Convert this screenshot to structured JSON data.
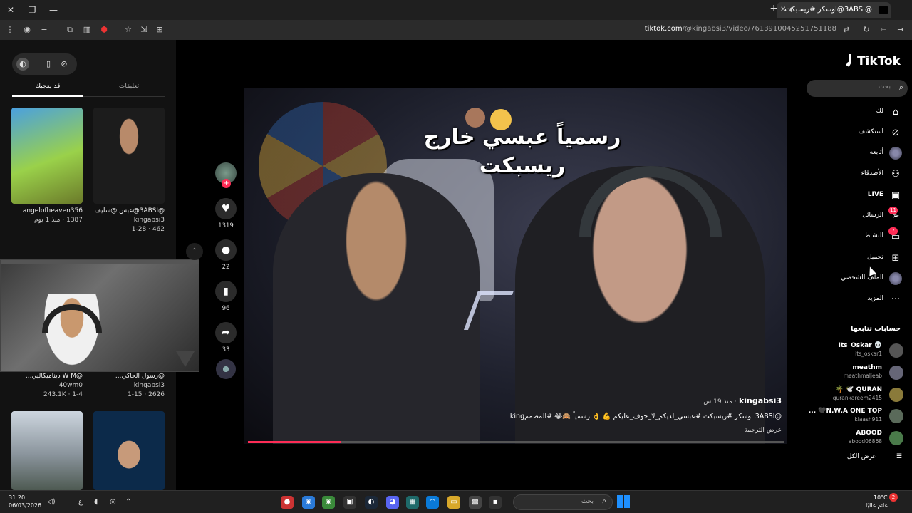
{
  "browser": {
    "tab_title": "@3ABSI@اوسكر #ريسبكت",
    "url_domain": "tiktok.com",
    "url_path": "/@kingabsi3/video/7613910045251751188"
  },
  "left_panel": {
    "tab_active": "قد يعجبك",
    "tab_other": "تعليقات",
    "cards": [
      {
        "title": "angelofheaven356",
        "meta": "1387 · منذ 1 يوم"
      },
      {
        "title": "@3ABSI@عبس @سليف 7madh@...",
        "sub": "kingabsi3",
        "meta": "462 · 1-28"
      },
      {
        "title": "@W M ديناميكاليي...",
        "sub": "40wm0",
        "meta": "243.1K · 1-4"
      },
      {
        "title": "@رسول الحاكي...",
        "sub": "kingabsi3",
        "meta": "2626 · 1-15"
      }
    ]
  },
  "video": {
    "caption_line1": "رسمياً عبسي خارج",
    "caption_line2": "ريسبكت",
    "author": "kingabsi3",
    "time_ago": "منذ 19 س",
    "description": "@3ABSI اوسكر #ريسبكت #عبسي_لديكم_لا_خوف_عليكم 💪 👌 رسمياً 🙈😂 #المصممking",
    "translate": "عرض الترجمة",
    "progress": 0.174
  },
  "actions": {
    "likes": "1319",
    "comments": "22",
    "saves": "96",
    "shares": "33"
  },
  "right_nav": {
    "brand": "TikTok",
    "search_placeholder": "بحث",
    "items": [
      {
        "label": "لك",
        "icon": "home-icon"
      },
      {
        "label": "استكشف",
        "icon": "compass-icon"
      },
      {
        "label": "أتابعه",
        "icon": "avatar-icon"
      },
      {
        "label": "الأصدقاء",
        "icon": "friends-icon"
      },
      {
        "label": "LIVE",
        "icon": "live-icon"
      },
      {
        "label": "الرسائل",
        "icon": "send-icon",
        "badge": "11"
      },
      {
        "label": "النشاط",
        "icon": "chat-icon",
        "badge": "7"
      },
      {
        "label": "تحميل",
        "icon": "upload-icon"
      },
      {
        "label": "الملف الشخصي",
        "icon": "profile-icon"
      },
      {
        "label": "المزيد",
        "icon": "more-icon"
      }
    ],
    "following_header": "حسابات تتابعها",
    "following": [
      {
        "name": "💀 Its_Oskar",
        "handle": "its_oskar1",
        "color": "#555"
      },
      {
        "name": "meathm",
        "handle": "meathmaljeab",
        "color": "#667"
      },
      {
        "name": "QURAN 🕊️ 🌴",
        "handle": "qurankareem2415",
        "color": "#8a7a3a"
      },
      {
        "name": "N.W.A ONE TOP🖤 ...",
        "handle": "klaash911",
        "color": "#5a6a5a"
      },
      {
        "name": "ABOOD",
        "handle": "abood06868",
        "color": "#4a7a4a"
      }
    ],
    "see_all": "عرض الكل"
  },
  "taskbar": {
    "time": "31:20",
    "date": "06/03/2026",
    "search_placeholder": "بحث",
    "temperature": "10°C",
    "weather_label": "غائم غالبًا",
    "notifications": "2",
    "lang": "ع"
  }
}
